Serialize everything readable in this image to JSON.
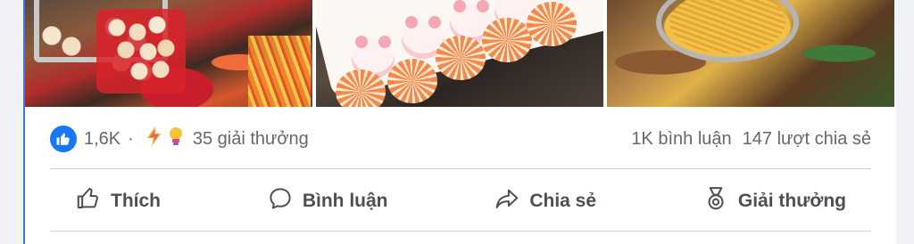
{
  "post": {
    "reactions": {
      "count": "1,6K",
      "separator": "·",
      "award_count": "35 giải thưởng"
    },
    "comments": "1K bình luận",
    "shares": "147 lượt chia sẻ",
    "actions": {
      "like": "Thích",
      "comment": "Bình luận",
      "share": "Chia sẻ",
      "award": "Giải thưởng"
    }
  },
  "colors": {
    "like_blue": "#1877f2",
    "text_secondary": "#65676b",
    "action_text": "#4b4f56"
  },
  "icons": {
    "like_badge": "thumbs-up-icon",
    "award_1": "lightning-icon",
    "award_2": "lightbulb-icon"
  }
}
